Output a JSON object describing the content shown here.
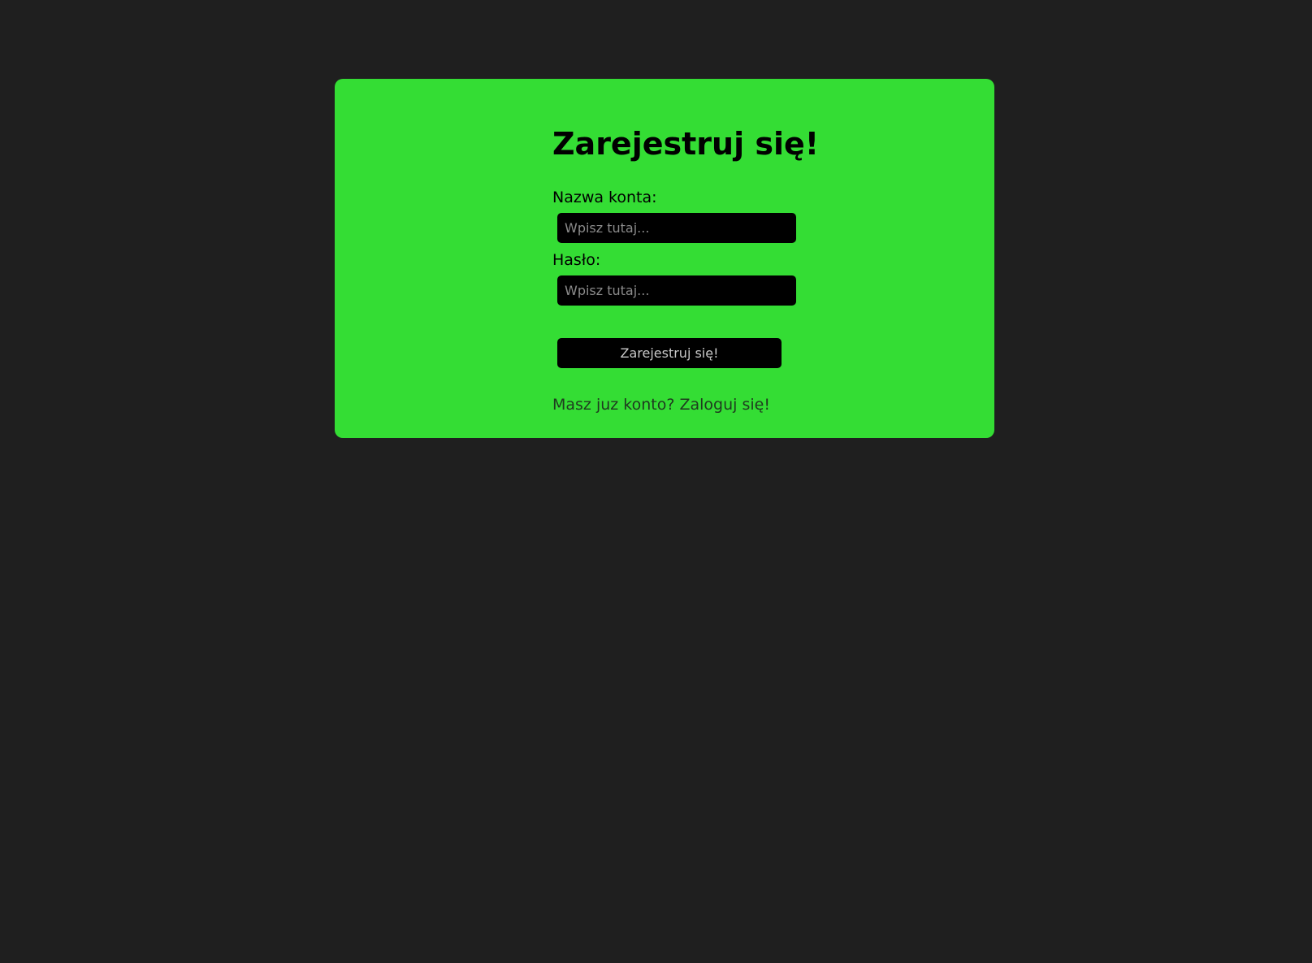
{
  "form": {
    "title": "Zarejestruj się!",
    "username_label": "Nazwa konta:",
    "username_placeholder": "Wpisz tutaj...",
    "password_label": "Hasło:",
    "password_placeholder": "Wpisz tutaj...",
    "submit_label": "Zarejestruj się!",
    "login_link": "Masz juz konto? Zaloguj się!"
  },
  "colors": {
    "background": "#1f1f1f",
    "card": "#34dd34",
    "input": "#000000"
  }
}
